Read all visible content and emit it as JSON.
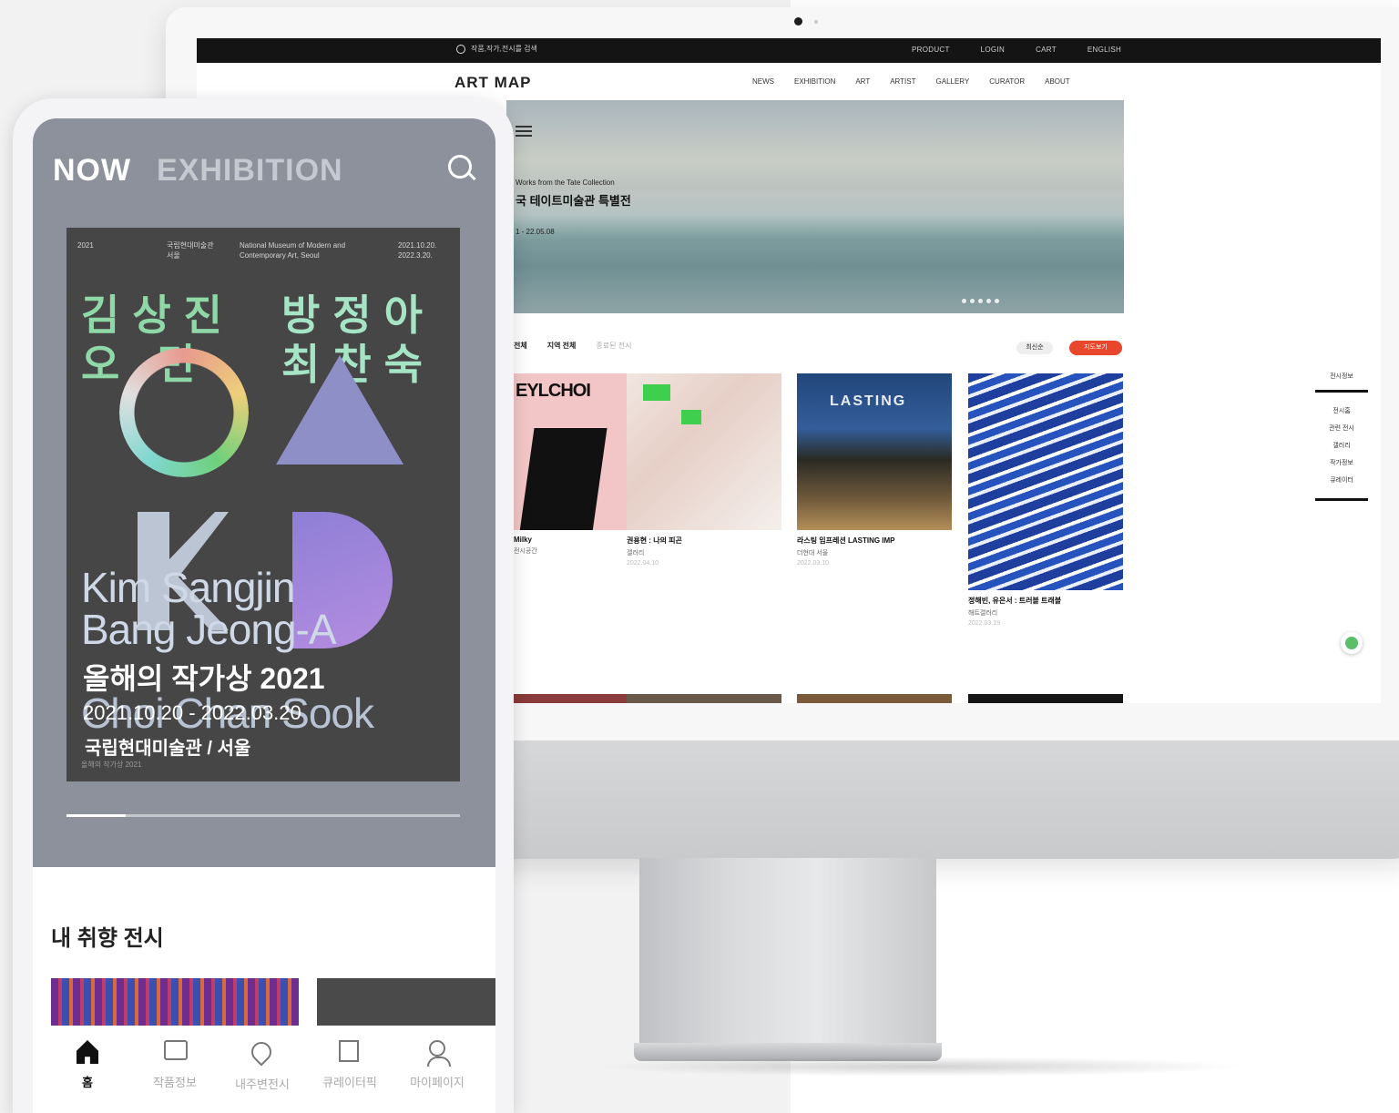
{
  "desktop": {
    "topbar": {
      "search_placeholder": "작품,작가,전시를 검색",
      "links": [
        "PRODUCT",
        "LOGIN",
        "CART",
        "ENGLISH"
      ]
    },
    "logo": "ART MAP",
    "menu": [
      "NEWS",
      "EXHIBITION",
      "ART",
      "ARTIST",
      "GALLERY",
      "CURATOR",
      "ABOUT"
    ],
    "hero": {
      "subtitle": "Works from the Tate Collection",
      "title": "국 테이트미술관 특별전",
      "date": "1 - 22.05.08"
    },
    "filters": [
      "전체",
      "지역 전체",
      "종료된 전시"
    ],
    "sort_label": "최신순",
    "cta_label": "지도보기",
    "cards": [
      {
        "art_text": "EYLCHOI",
        "title": "Milky",
        "subtitle": "전시공간",
        "date": ""
      },
      {
        "art_text": "",
        "title": "권용현 : 나의 피곤",
        "subtitle": "갤러리",
        "date": "2022.04.10"
      },
      {
        "art_text": "LASTING",
        "title": "라스팅 임프레션 LASTING IMP",
        "subtitle": "더현대 서울",
        "date": "2022.03.10"
      },
      {
        "art_text": "",
        "title": "정해빈, 유은서 : 트러블 트래블",
        "subtitle": "해트갤러리",
        "date": "2022.03.19"
      }
    ],
    "side_panel": {
      "label": "전시정보",
      "items": [
        "전시홈",
        "관련 전시",
        "갤러리",
        "작가정보",
        "큐레이터"
      ]
    }
  },
  "mobile": {
    "header_now": "NOW",
    "header_exhibition": "EXHIBITION",
    "poster": {
      "meta_left": "2021",
      "meta_org": "국립현대미술관 서울",
      "meta_museum": "National Museum of Modern and Contemporary Art, Seoul",
      "meta_dates": "2021.10.20. 2022.3.20.",
      "hangul_line1_left": "김상진",
      "hangul_line2_left": "오 민",
      "hangul_line1_right": "방정아",
      "hangul_line2_right": "최찬숙",
      "name_line1": "Kim Sangjin",
      "name_line2": "Bang Jeong-A",
      "name_line3": "Choi Chan Sook",
      "year_title": "올해의 작가상 2021",
      "dates": "2021.10.20 - 2022.03.20",
      "venue": "국립현대미술관 / 서울",
      "footer": "올해의 작가상 2021"
    },
    "progress_fraction": 0.15,
    "section_title": "내 취향 전시",
    "tabs": [
      {
        "label": "홈",
        "icon": "home-icon",
        "active": true
      },
      {
        "label": "작품정보",
        "icon": "artwork-icon",
        "active": false
      },
      {
        "label": "내주변전시",
        "icon": "location-pin-icon",
        "active": false
      },
      {
        "label": "큐레이터픽",
        "icon": "book-icon",
        "active": false
      },
      {
        "label": "마이페이지",
        "icon": "user-icon",
        "active": false
      }
    ]
  }
}
